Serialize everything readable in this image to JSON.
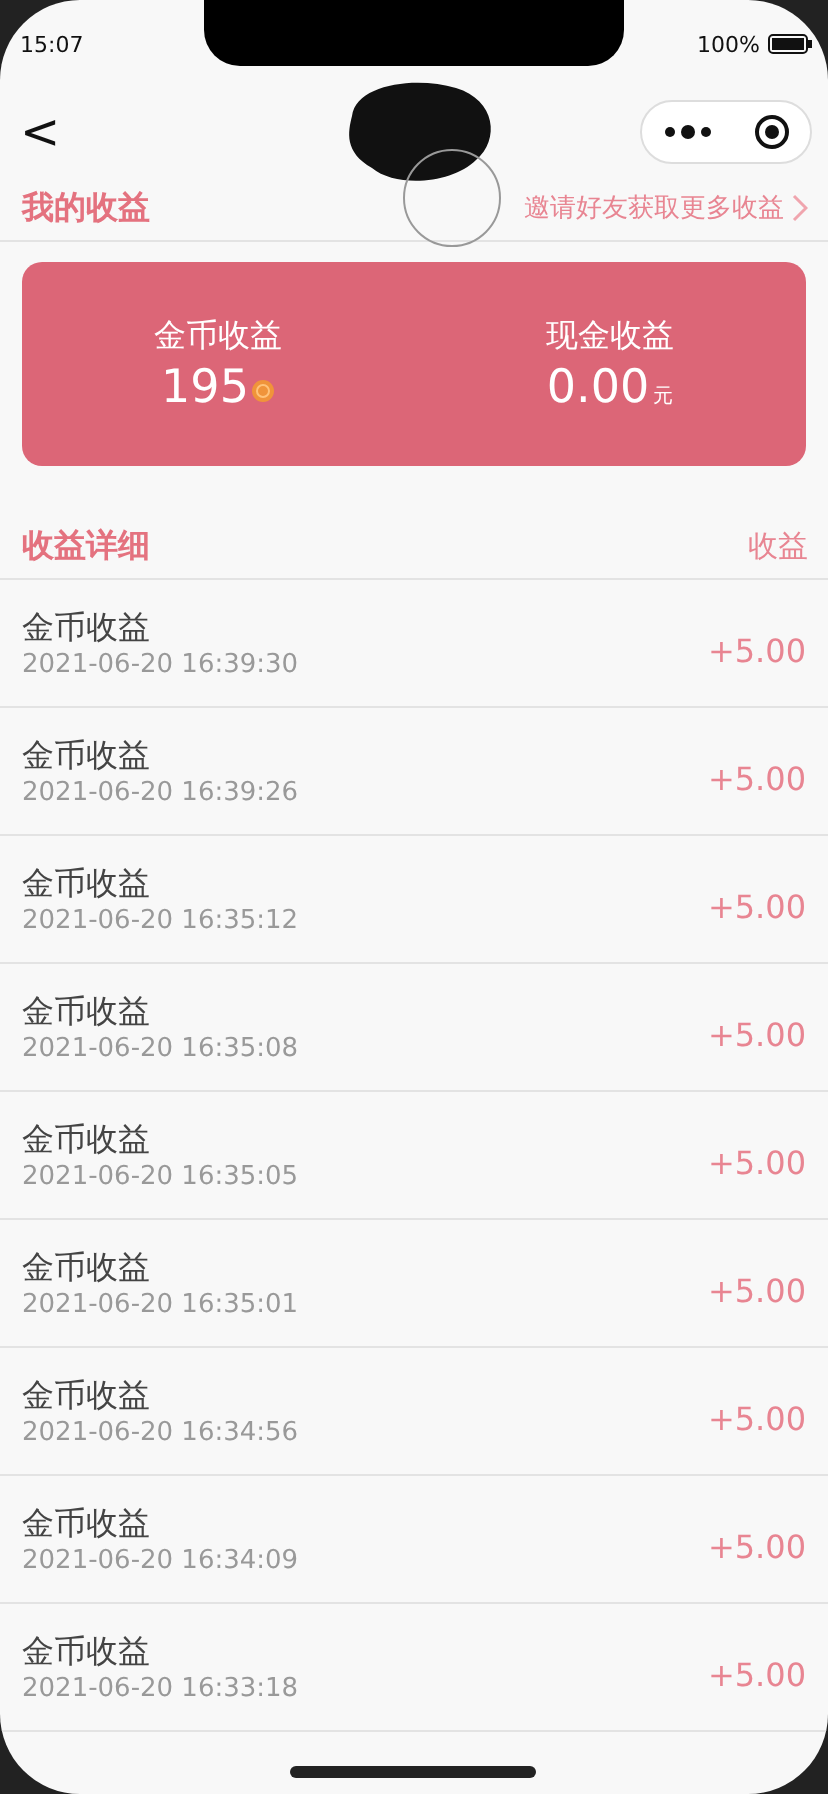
{
  "status_bar": {
    "time": "15:07",
    "battery": "100%"
  },
  "nav": {
    "back": "<"
  },
  "summary": {
    "title": "我的收益",
    "link": "邀请好友获取更多收益",
    "coin_label": "金币收益",
    "coin_value": "195",
    "cash_label": "现金收益",
    "cash_value": "0.00",
    "cash_unit": "元"
  },
  "details": {
    "title": "收益详细",
    "column": "收益"
  },
  "records": [
    {
      "name": "金币收益",
      "time": "2021-06-20 16:39:30",
      "amount": "+5.00"
    },
    {
      "name": "金币收益",
      "time": "2021-06-20 16:39:26",
      "amount": "+5.00"
    },
    {
      "name": "金币收益",
      "time": "2021-06-20 16:35:12",
      "amount": "+5.00"
    },
    {
      "name": "金币收益",
      "time": "2021-06-20 16:35:08",
      "amount": "+5.00"
    },
    {
      "name": "金币收益",
      "time": "2021-06-20 16:35:05",
      "amount": "+5.00"
    },
    {
      "name": "金币收益",
      "time": "2021-06-20 16:35:01",
      "amount": "+5.00"
    },
    {
      "name": "金币收益",
      "time": "2021-06-20 16:34:56",
      "amount": "+5.00"
    },
    {
      "name": "金币收益",
      "time": "2021-06-20 16:34:09",
      "amount": "+5.00"
    },
    {
      "name": "金币收益",
      "time": "2021-06-20 16:33:18",
      "amount": "+5.00"
    }
  ]
}
